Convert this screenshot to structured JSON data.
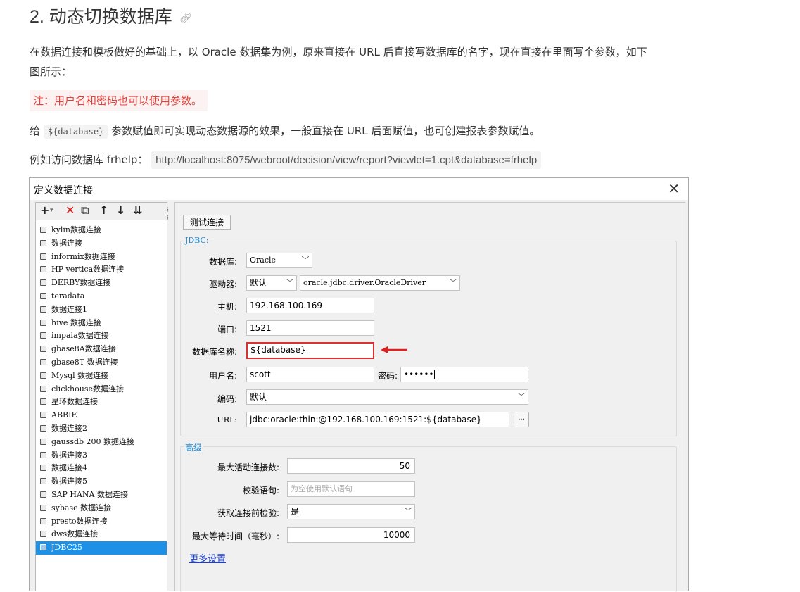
{
  "heading": "2. 动态切换数据库",
  "anchor_icon": "link-icon",
  "intro_line1": "在数据连接和模板做好的基础上，以 Oracle 数据集为例，原来直接在 URL 后直接写数据库的名字，现在直接在里面写个参数，如下",
  "intro_line2": "图所示：",
  "note": "注：用户名和密码也可以使用参数。",
  "para2": {
    "before": "给",
    "code": "${database}",
    "after": "参数赋值即可实现动态数据源的效果，一般直接在 URL 后面赋值，也可创建报表参数赋值。"
  },
  "para3": {
    "before": "例如访问数据库 frhelp：",
    "code": "http://localhost:8075/webroot/decision/view/report?viewlet=1.cpt&database=frhelp"
  },
  "dialog": {
    "title": "定义数据连接",
    "close": "✕",
    "toolbar": [
      "+",
      "▾",
      "✕",
      "⧉",
      "↑",
      "↓",
      "⇊"
    ],
    "connections": [
      "kylin数据连接",
      "数据连接",
      "informix数据连接",
      "HP vertica数据连接",
      "DERBY数据连接",
      "teradata",
      "数据连接1",
      "hive 数据连接",
      "impala数据连接",
      "gbase8A数据连接",
      "gbase8T 数据连接",
      "Mysql 数据连接",
      "clickhouse数据连接",
      "星环数据连接",
      "ABBIE",
      "数据连接2",
      "gaussdb 200 数据连接",
      "数据连接3",
      "数据连接4",
      "数据连接5",
      "SAP HANA 数据连接",
      "sybase 数据连接",
      "presto数据连接",
      "dws数据连接",
      "JDBC25"
    ],
    "selected_index": 24,
    "test_button": "测试连接",
    "jdbc": {
      "group_title": "JDBC:",
      "db_label": "数据库:",
      "db_value": "Oracle",
      "driver_label": "驱动器:",
      "driver_mode": "默认",
      "driver_class": "oracle.jdbc.driver.OracleDriver",
      "host_label": "主机:",
      "host_value": "192.168.100.169",
      "port_label": "端口:",
      "port_value": "1521",
      "dbname_label": "数据库名称:",
      "dbname_value": "${database}",
      "user_label": "用户名:",
      "user_value": "scott",
      "pwd_label": "密码:",
      "pwd_value": "••••••",
      "enc_label": "编码:",
      "enc_value": "默认",
      "url_label": "URL:",
      "url_value": "jdbc:oracle:thin:@192.168.100.169:1521:${database}",
      "url_more": "..."
    },
    "advanced": {
      "group_title": "高级",
      "max_active_label": "最大活动连接数:",
      "max_active_value": "50",
      "validation_label": "校验语句:",
      "validation_placeholder": "为空使用默认语句",
      "test_before_label": "获取连接前检验:",
      "test_before_value": "是",
      "max_wait_label": "最大等待时间（毫秒）:",
      "max_wait_value": "10000",
      "more_settings": "更多设置"
    },
    "arrow_color": "#e02020"
  }
}
